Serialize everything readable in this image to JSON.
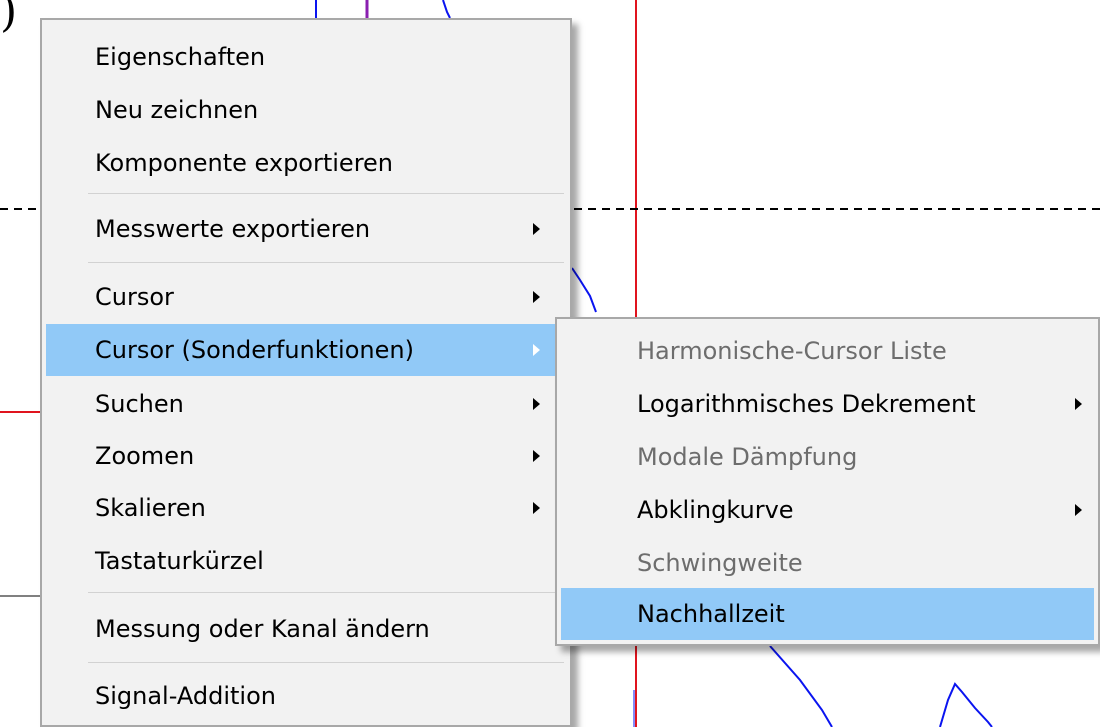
{
  "background": {
    "fragment_text": ")",
    "colors": {
      "cursor_line": "#e0141e",
      "signal": "#0a14f0",
      "marker": "#8a1fb0",
      "dashed_line": "#000000"
    }
  },
  "main_menu": {
    "items": [
      {
        "label": "Eigenschaften"
      },
      {
        "label": "Neu zeichnen"
      },
      {
        "label": "Komponente exportieren"
      },
      {
        "label": "Messwerte exportieren",
        "submenu": true
      },
      {
        "label": "Cursor",
        "submenu": true
      },
      {
        "label": "Cursor (Sonderfunktionen)",
        "submenu": true,
        "highlighted": true
      },
      {
        "label": "Suchen",
        "submenu": true
      },
      {
        "label": "Zoomen",
        "submenu": true
      },
      {
        "label": "Skalieren",
        "submenu": true
      },
      {
        "label": "Tastaturkürzel"
      },
      {
        "label": "Messung oder Kanal ändern"
      },
      {
        "label": "Signal-Addition"
      }
    ]
  },
  "sub_menu": {
    "items": [
      {
        "label": "Harmonische-Cursor Liste",
        "disabled": true
      },
      {
        "label": "Logarithmisches Dekrement",
        "submenu": true
      },
      {
        "label": "Modale Dämpfung",
        "disabled": true
      },
      {
        "label": "Abklingkurve",
        "submenu": true
      },
      {
        "label": "Schwingweite",
        "disabled": true
      },
      {
        "label": "Nachhallzeit",
        "highlighted": true
      }
    ]
  },
  "highlight_color": "#91c9f7"
}
